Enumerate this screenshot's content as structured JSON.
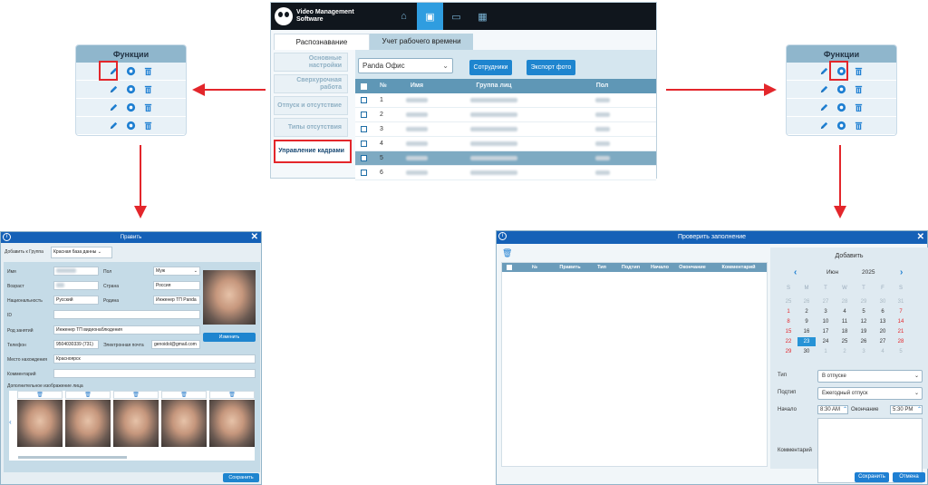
{
  "left_panel": {
    "title": "Функции"
  },
  "right_panel": {
    "title": "Функции"
  },
  "main": {
    "app_title_line1": "Video Management",
    "app_title_line2": "Software",
    "tabs": [
      {
        "label": "Распознавание"
      },
      {
        "label": "Учет рабочего времени"
      }
    ],
    "sidebar": [
      {
        "label": "Основные настройки"
      },
      {
        "label": "Сверхурочная работа"
      },
      {
        "label": "Отпуск и отсутствие"
      },
      {
        "label": "Типы отсутствия"
      },
      {
        "label": "Управление кадрами"
      }
    ],
    "group_select": "Panda Офис",
    "btn_staff": "Сотрудники",
    "btn_export": "Экспорт фото",
    "columns": [
      "№",
      "Имя",
      "Группа лиц",
      "Пол"
    ],
    "rows": [
      "1",
      "2",
      "3",
      "4",
      "5",
      "6"
    ]
  },
  "edit": {
    "title": "Править",
    "add_to_group_label": "Добавить к Группа",
    "add_to_group_value": "Красная база данны",
    "labels": {
      "name": "Имя",
      "gender": "Пол",
      "age": "Возраст",
      "country": "Страна",
      "nationality": "Национальность",
      "homeland": "Родина",
      "id": "ID",
      "occupation": "Род занятий",
      "phone": "Телефон",
      "email": "Электронная почта",
      "location": "Место нахождения",
      "comment": "Комментарий",
      "extra_images": "Дополнительное изображение лица"
    },
    "values": {
      "gender": "Муж",
      "country": "Россия",
      "nationality": "Русский",
      "homeland": "Инженер ТП Panda",
      "occupation": "Инженер ТП видеонаблюдения",
      "phone": "9504030339 (731)",
      "email": "genoidol@gmail.com",
      "location": "Красноярск"
    },
    "change_btn": "Изменить",
    "save_btn": "Сохранить"
  },
  "check": {
    "title": "Проверить заполнение",
    "columns": [
      "№",
      "Править",
      "Тип",
      "Подтип",
      "Начало",
      "Окончание",
      "Комментарий"
    ],
    "add_label": "Добавить",
    "month": "Июн",
    "year": "2025",
    "weekdays": [
      "S",
      "M",
      "T",
      "W",
      "T",
      "F",
      "S"
    ],
    "days": [
      [
        "25",
        "26",
        "27",
        "28",
        "29",
        "30",
        "31"
      ],
      [
        "1",
        "2",
        "3",
        "4",
        "5",
        "6",
        "7"
      ],
      [
        "8",
        "9",
        "10",
        "11",
        "12",
        "13",
        "14"
      ],
      [
        "15",
        "16",
        "17",
        "18",
        "19",
        "20",
        "21"
      ],
      [
        "22",
        "23",
        "24",
        "25",
        "26",
        "27",
        "28"
      ],
      [
        "29",
        "30",
        "1",
        "2",
        "3",
        "4",
        "5"
      ]
    ],
    "type_label": "Тип",
    "type_value": "В отпуске",
    "subtype_label": "Подтип",
    "subtype_value": "Ежегодный отпуск",
    "start_label": "Начало",
    "start_value": "8:30 AM",
    "end_label": "Окончание",
    "end_value": "5:30 PM",
    "comment_label": "Комментарий",
    "save_btn": "Сохранить",
    "cancel_btn": "Отмена"
  },
  "colors": {
    "accent": "#1e85cf",
    "highlight": "#e3262b",
    "icon": "#1e7fd2"
  }
}
